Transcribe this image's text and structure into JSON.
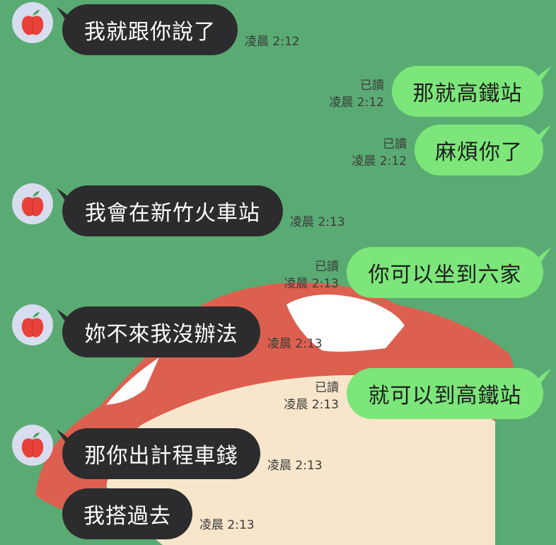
{
  "colors": {
    "background": "#5aab73",
    "incoming_bubble": "#2c2c2e",
    "outgoing_bubble": "#7ce67a",
    "avatar_bg": "#d7dcef",
    "art_red": "#dd5f4f",
    "art_cream": "#f7e6cb"
  },
  "contact": {
    "avatar_icon": "apple-icon"
  },
  "messages": [
    {
      "side": "in",
      "text": "我就跟你說了",
      "time": "凌晨 2:12"
    },
    {
      "side": "out",
      "text": "那就高鐵站",
      "read": "已讀",
      "time": "凌晨 2:12"
    },
    {
      "side": "out",
      "text": "麻煩你了",
      "read": "已讀",
      "time": "凌晨 2:12"
    },
    {
      "side": "in",
      "text": "我會在新竹火車站",
      "time": "凌晨 2:13"
    },
    {
      "side": "out",
      "text": "你可以坐到六家",
      "read": "已讀",
      "time": "凌晨 2:13"
    },
    {
      "side": "in",
      "text": "妳不來我沒辦法",
      "time": "凌晨 2:13"
    },
    {
      "side": "out",
      "text": "就可以到高鐵站",
      "read": "已讀",
      "time": "凌晨 2:13"
    },
    {
      "side": "in",
      "text": "那你出計程車錢",
      "time": "凌晨 2:13"
    },
    {
      "side": "in",
      "text": "我搭過去",
      "time": "凌晨 2:13"
    }
  ]
}
